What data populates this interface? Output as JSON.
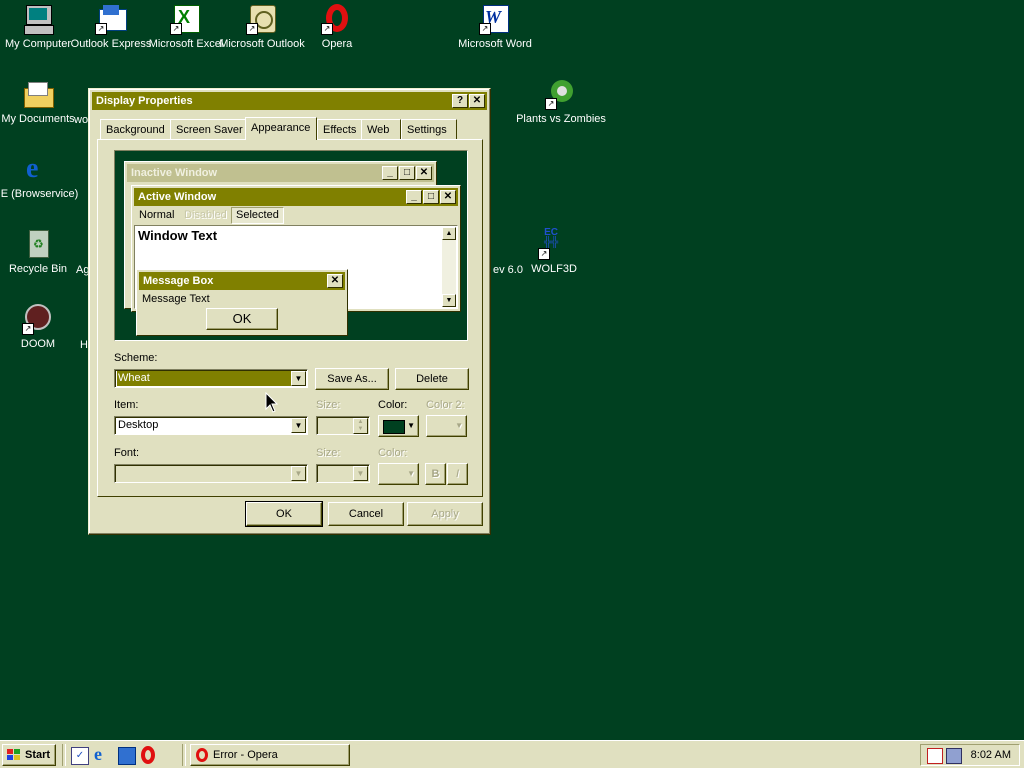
{
  "desktop": {
    "background_color": "#004020",
    "icons": [
      {
        "label": "My Computer",
        "icon": "computer-icon"
      },
      {
        "label": "Outlook Express",
        "icon": "outlook-express-icon"
      },
      {
        "label": "Microsoft Excel",
        "icon": "excel-icon"
      },
      {
        "label": "Microsoft Outlook",
        "icon": "outlook-icon"
      },
      {
        "label": "Opera",
        "icon": "opera-icon"
      },
      {
        "label": "Microsoft Word",
        "icon": "word-icon"
      },
      {
        "label": "My Documents",
        "icon": "folder-icon"
      },
      {
        "label": "Plants vs Zombies",
        "icon": "plants-icon"
      },
      {
        "label": "IE (Browservice)",
        "icon": "ie-icon"
      },
      {
        "label": "Recycle Bin",
        "icon": "recycle-bin-icon"
      },
      {
        "label": "WOLF3D",
        "icon": "wolf3d-icon"
      },
      {
        "label": "DOOM",
        "icon": "doom-icon"
      }
    ],
    "partial_labels": [
      "wo",
      "Ag",
      "H",
      "ev 6.0"
    ]
  },
  "dialog": {
    "title": "Display Properties",
    "help_btn": "?",
    "close_btn": "✕",
    "tabs": [
      "Background",
      "Screen Saver",
      "Appearance",
      "Effects",
      "Web",
      "Settings"
    ],
    "preview": {
      "inactive_title": "Inactive Window",
      "active_title": "Active Window",
      "menu": {
        "normal": "Normal",
        "disabled": "Disabled",
        "selected": "Selected"
      },
      "window_text": "Window Text",
      "msgbox_title": "Message Box",
      "msgbox_text": "Message Text",
      "msgbox_ok": "OK"
    },
    "scheme_label": "Scheme:",
    "scheme_value": "Wheat",
    "save_as": "Save As...",
    "delete": "Delete",
    "item_label": "Item:",
    "item_value": "Desktop",
    "size_label": "Size:",
    "color_label": "Color:",
    "color2_label": "Color 2:",
    "font_label": "Font:",
    "font_size_label": "Size:",
    "font_color_label": "Color:",
    "bold": "B",
    "italic": "I",
    "ok": "OK",
    "cancel": "Cancel",
    "apply": "Apply",
    "colors": {
      "title_active": "#808000",
      "title_inactive": "#c0c090",
      "face": "#e0e0c0",
      "item_color": "#004020"
    }
  },
  "taskbar": {
    "start": "Start",
    "quicklaunch": [
      "show-desktop-icon",
      "ie-icon",
      "outlook-express-icon",
      "opera-icon"
    ],
    "tasks": [
      {
        "label": "Error - Opera",
        "icon": "opera-icon"
      }
    ],
    "clock": "8:02 AM"
  }
}
